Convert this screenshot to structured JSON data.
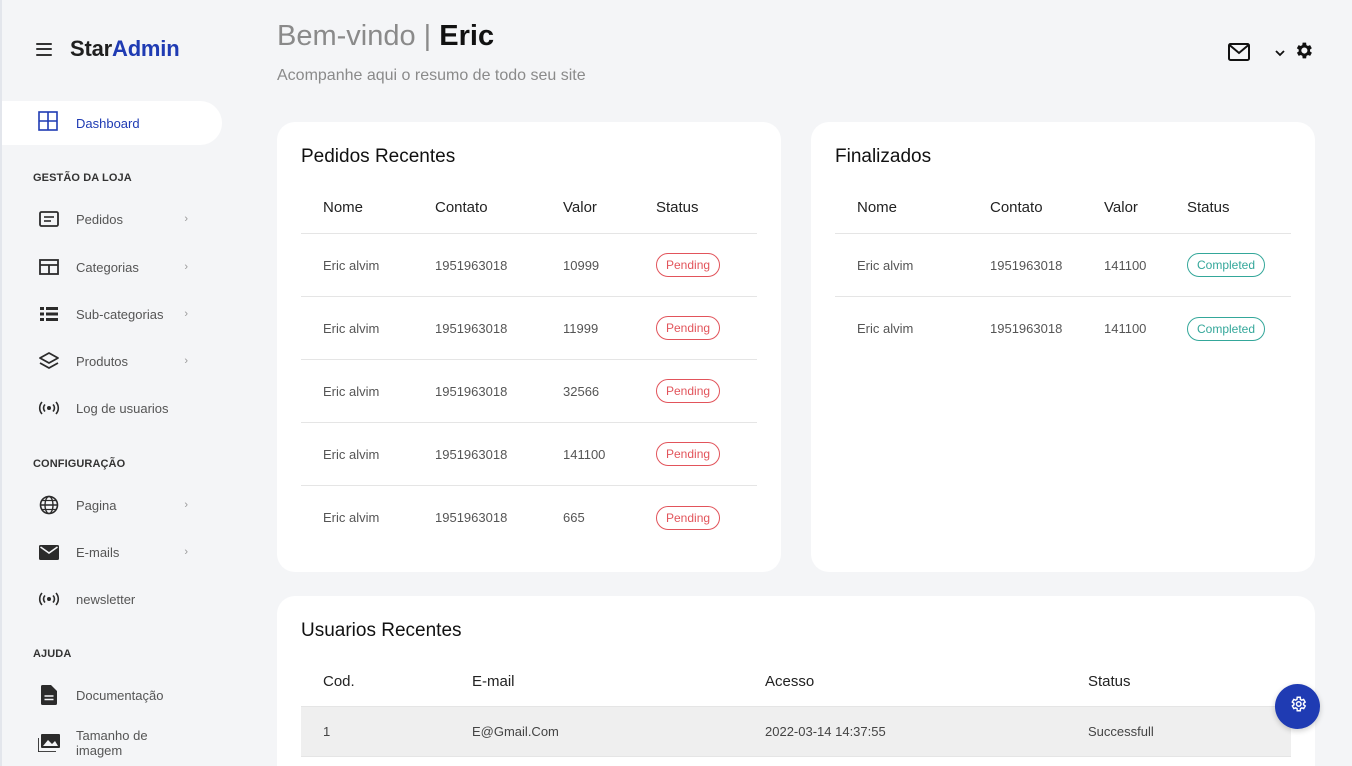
{
  "brand": {
    "star": "Star",
    "admin": "Admin"
  },
  "header": {
    "greeting": "Bem-vindo | ",
    "user_name": "Eric",
    "subtitle": "Acompanhe aqui o resumo de todo seu site"
  },
  "sidebar": {
    "dashboard": "Dashboard",
    "sections": [
      {
        "title": "GESTÃO DA LOJA",
        "items": [
          {
            "label": "Pedidos",
            "icon": "list-alt-icon",
            "chevron": true
          },
          {
            "label": "Categorias",
            "icon": "table-icon",
            "chevron": true
          },
          {
            "label": "Sub-categorias",
            "icon": "list-icon",
            "chevron": true
          },
          {
            "label": "Produtos",
            "icon": "layers-icon",
            "chevron": true
          },
          {
            "label": "Log de usuarios",
            "icon": "broadcast-icon",
            "chevron": false
          }
        ]
      },
      {
        "title": "CONFIGURAÇÃO",
        "items": [
          {
            "label": "Pagina",
            "icon": "globe-icon",
            "chevron": true
          },
          {
            "label": "E-mails",
            "icon": "envelope-icon",
            "chevron": true
          },
          {
            "label": "newsletter",
            "icon": "broadcast-icon",
            "chevron": false
          }
        ]
      },
      {
        "title": "AJUDA",
        "items": [
          {
            "label": "Documentação",
            "icon": "document-icon",
            "chevron": false
          },
          {
            "label": "Tamanho de imagem",
            "icon": "images-icon",
            "chevron": false
          }
        ]
      }
    ],
    "chevron_glyph": "›"
  },
  "recent_orders": {
    "title": "Pedidos Recentes",
    "columns": [
      "Nome",
      "Contato",
      "Valor",
      "Status"
    ],
    "rows": [
      [
        "Eric alvim",
        "1951963018",
        "10999",
        "Pending"
      ],
      [
        "Eric alvim",
        "1951963018",
        "11999",
        "Pending"
      ],
      [
        "Eric alvim",
        "1951963018",
        "32566",
        "Pending"
      ],
      [
        "Eric alvim",
        "1951963018",
        "141100",
        "Pending"
      ],
      [
        "Eric alvim",
        "1951963018",
        "665",
        "Pending"
      ]
    ]
  },
  "finished": {
    "title": "Finalizados",
    "columns": [
      "Nome",
      "Contato",
      "Valor",
      "Status"
    ],
    "rows": [
      [
        "Eric alvim",
        "1951963018",
        "141100",
        "Completed"
      ],
      [
        "Eric alvim",
        "1951963018",
        "141100",
        "Completed"
      ]
    ]
  },
  "recent_users": {
    "title": "Usuarios Recentes",
    "columns": [
      "Cod.",
      "E-mail",
      "Acesso",
      "Status"
    ],
    "rows": [
      [
        "1",
        "E@Gmail.Com",
        "2022-03-14 14:37:55",
        "Successfull"
      ]
    ]
  },
  "colors": {
    "accent": "#1f3bb3",
    "pending": "#e2545b",
    "completed": "#34a79a"
  }
}
